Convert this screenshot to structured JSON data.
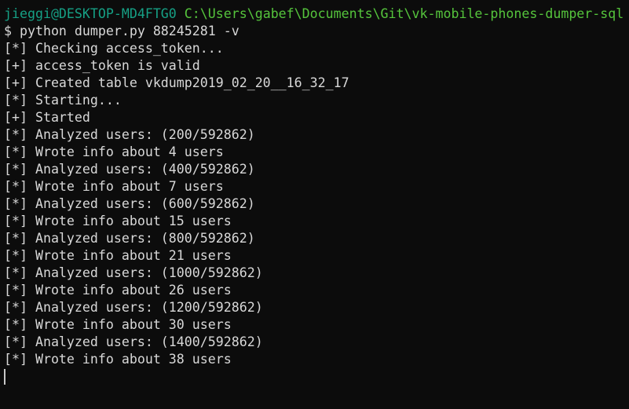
{
  "prompt": {
    "user_host": "jieggi@DESKTOP-MD4FTG0",
    "cwd": "C:\\Users\\gabef\\Documents\\Git\\vk-mobile-phones-dumper-sql",
    "command": "$ python dumper.py 88245281 -v"
  },
  "output": [
    "[*] Checking access_token...",
    "[+] access_token is valid",
    "[+] Created table vkdump2019_02_20__16_32_17",
    "[*] Starting...",
    "[+] Started",
    "[*] Analyzed users: (200/592862)",
    "[*] Wrote info about 4 users",
    "[*] Analyzed users: (400/592862)",
    "[*] Wrote info about 7 users",
    "[*] Analyzed users: (600/592862)",
    "[*] Wrote info about 15 users",
    "[*] Analyzed users: (800/592862)",
    "[*] Wrote info about 21 users",
    "[*] Analyzed users: (1000/592862)",
    "[*] Wrote info about 26 users",
    "[*] Analyzed users: (1200/592862)",
    "[*] Wrote info about 30 users",
    "[*] Analyzed users: (1400/592862)",
    "[*] Wrote info about 38 users"
  ],
  "colors": {
    "background": "#0c0c0c",
    "text": "#d8d8d8",
    "user_host": "#16a085",
    "cwd": "#55c43c"
  }
}
